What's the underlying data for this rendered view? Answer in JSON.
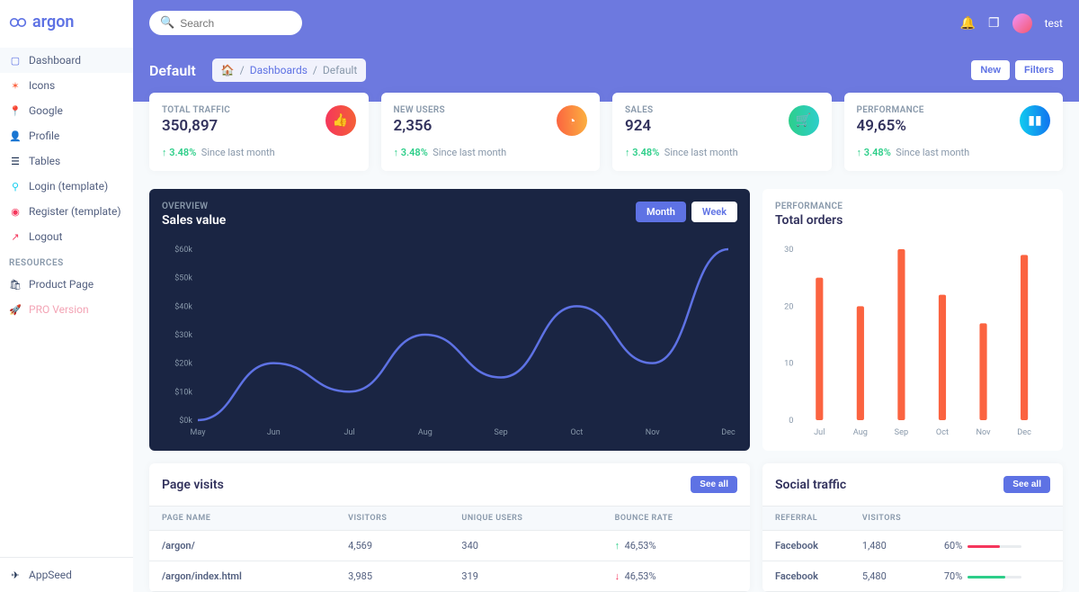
{
  "brand": "argon",
  "search": {
    "placeholder": "Search"
  },
  "user": {
    "name": "test"
  },
  "sidebar": {
    "items": [
      {
        "label": "Dashboard",
        "icon": "tv-icon",
        "color": "blue",
        "active": true
      },
      {
        "label": "Icons",
        "icon": "atom-icon",
        "color": "orange"
      },
      {
        "label": "Google",
        "icon": "pin-icon",
        "color": "blue"
      },
      {
        "label": "Profile",
        "icon": "user-icon",
        "color": "yellow"
      },
      {
        "label": "Tables",
        "icon": "list-icon",
        "color": "gray"
      },
      {
        "label": "Login (template)",
        "icon": "key-icon",
        "color": "cyan"
      },
      {
        "label": "Register (template)",
        "icon": "circle-icon",
        "color": "pinkish"
      },
      {
        "label": "Logout",
        "icon": "run-icon",
        "color": "red"
      }
    ],
    "resources_header": "RESOURCES",
    "resources": [
      {
        "label": "Product Page",
        "icon": "bag-icon",
        "color": "gray"
      },
      {
        "label": "PRO Version",
        "icon": "rocket-icon",
        "color": "pink",
        "pink_text": true
      }
    ],
    "footer": "AppSeed"
  },
  "page": {
    "title": "Default",
    "crumb1": "Dashboards",
    "crumb2": "Default",
    "btn_new": "New",
    "btn_filters": "Filters"
  },
  "stats": [
    {
      "label": "TOTAL TRAFFIC",
      "value": "350,897",
      "delta": "3.48%",
      "since": "Since last month",
      "iconClass": "ic-red",
      "icon": "thumb-icon"
    },
    {
      "label": "NEW USERS",
      "value": "2,356",
      "delta": "3.48%",
      "since": "Since last month",
      "iconClass": "ic-orange",
      "icon": "pie-icon"
    },
    {
      "label": "SALES",
      "value": "924",
      "delta": "3.48%",
      "since": "Since last month",
      "iconClass": "ic-green",
      "icon": "cart-icon"
    },
    {
      "label": "PERFORMANCE",
      "value": "49,65%",
      "delta": "3.48%",
      "since": "Since last month",
      "iconClass": "ic-blue",
      "icon": "bar-icon"
    }
  ],
  "sales_chart": {
    "overline": "OVERVIEW",
    "title": "Sales value",
    "tab_month": "Month",
    "tab_week": "Week"
  },
  "orders_chart": {
    "overline": "PERFORMANCE",
    "title": "Total orders"
  },
  "page_visits": {
    "title": "Page visits",
    "see_all": "See all",
    "cols": [
      "PAGE NAME",
      "VISITORS",
      "UNIQUE USERS",
      "BOUNCE RATE"
    ],
    "rows": [
      {
        "name": "/argon/",
        "visitors": "4,569",
        "unique": "340",
        "rate": "46,53%",
        "dir": "up"
      },
      {
        "name": "/argon/index.html",
        "visitors": "3,985",
        "unique": "319",
        "rate": "46,53%",
        "dir": "down"
      }
    ]
  },
  "social": {
    "title": "Social traffic",
    "see_all": "See all",
    "cols": [
      "REFERRAL",
      "VISITORS",
      ""
    ],
    "rows": [
      {
        "ref": "Facebook",
        "visitors": "1,480",
        "pct": "60%",
        "bar": 60,
        "color": "#f5365c"
      },
      {
        "ref": "Facebook",
        "visitors": "5,480",
        "pct": "70%",
        "bar": 70,
        "color": "#2dce89"
      }
    ]
  },
  "chart_data": [
    {
      "type": "line",
      "title": "Sales value",
      "xlabel": "",
      "ylabel": "",
      "categories": [
        "May",
        "Jun",
        "Jul",
        "Aug",
        "Sep",
        "Oct",
        "Nov",
        "Dec"
      ],
      "values": [
        0,
        20,
        10,
        30,
        15,
        40,
        20,
        60
      ],
      "ylim": [
        0,
        60
      ],
      "yticks": [
        "$0k",
        "$10k",
        "$20k",
        "$30k",
        "$40k",
        "$50k",
        "$60k"
      ]
    },
    {
      "type": "bar",
      "title": "Total orders",
      "xlabel": "",
      "ylabel": "",
      "categories": [
        "Jul",
        "Aug",
        "Sep",
        "Oct",
        "Nov",
        "Dec"
      ],
      "values": [
        25,
        20,
        30,
        22,
        17,
        29
      ],
      "ylim": [
        0,
        30
      ],
      "yticks": [
        0,
        10,
        20,
        30
      ]
    }
  ]
}
